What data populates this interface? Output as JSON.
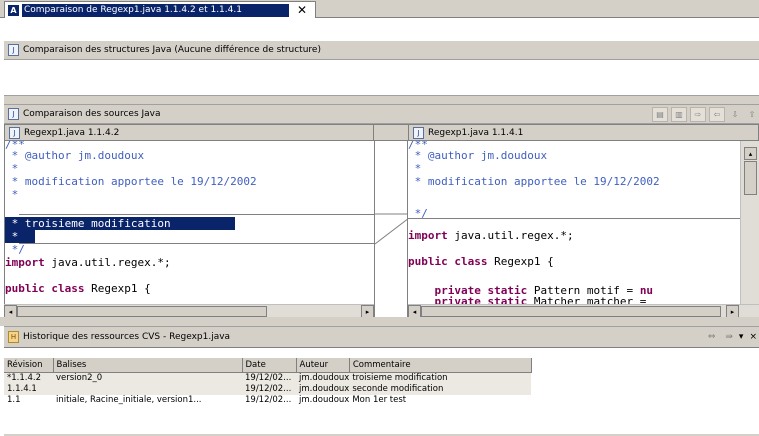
{
  "window": {
    "tab_title": "Comparaison de Regexp1.java 1.1.4.2 et 1.1.4.1",
    "tab_icon_glyph": "A",
    "close_glyph": "✕"
  },
  "structure_panel": {
    "title": "Comparaison des structures Java  (Aucune différence de structure)"
  },
  "source_panel": {
    "title": "Comparaison des sources Java",
    "left_file": "Regexp1.java 1.1.4.2",
    "right_file": "Regexp1.java 1.1.4.1",
    "left_code": {
      "l1": "/**",
      "l2": " * @author jm.doudoux",
      "l3": " *",
      "l4": " * modification apportee le 19/12/2002",
      "l5": " *",
      "l6": " * troisieme modification",
      "l7": " *",
      "l8": " */",
      "l9_kw": "import",
      "l9_rest": " java.util.regex.*;",
      "l10_kw": "public class",
      "l10_rest": " Regexp1 {"
    },
    "right_code": {
      "l1": "/**",
      "l2": " * @author jm.doudoux",
      "l3": " *",
      "l4": " * modification apportee le 19/12/2002",
      "l5": " */",
      "l6_kw": "import",
      "l6_rest": " java.util.regex.*;",
      "l7_kw": "public class",
      "l7_rest": " Regexp1 {",
      "l8_kw": "    private static",
      "l8_rest": " Pattern motif = ",
      "l8_tail": "nu",
      "l9_kw": "    private static",
      "l9_rest": " Matcher matcher = "
    }
  },
  "history": {
    "title": "Historique des ressources CVS - Regexp1.java",
    "columns": [
      "Révision",
      "Balises",
      "Date",
      "Auteur",
      "Commentaire"
    ],
    "rows": [
      [
        "*1.1.4.2",
        "version2_0",
        "19/12/02...",
        "jm.doudoux",
        "troisieme modification"
      ],
      [
        "1.1.4.1",
        "",
        "19/12/02...",
        "jm.doudoux",
        "seconde modification"
      ],
      [
        "1.1",
        "initiale, Racine_initiale, version1...",
        "19/12/02...",
        "jm.doudoux",
        "Mon 1er test"
      ]
    ]
  },
  "colors": {
    "selection": "#0a246a",
    "comment": "#3f5fbf",
    "keyword": "#7f0055",
    "panel": "#d4d0c8"
  }
}
